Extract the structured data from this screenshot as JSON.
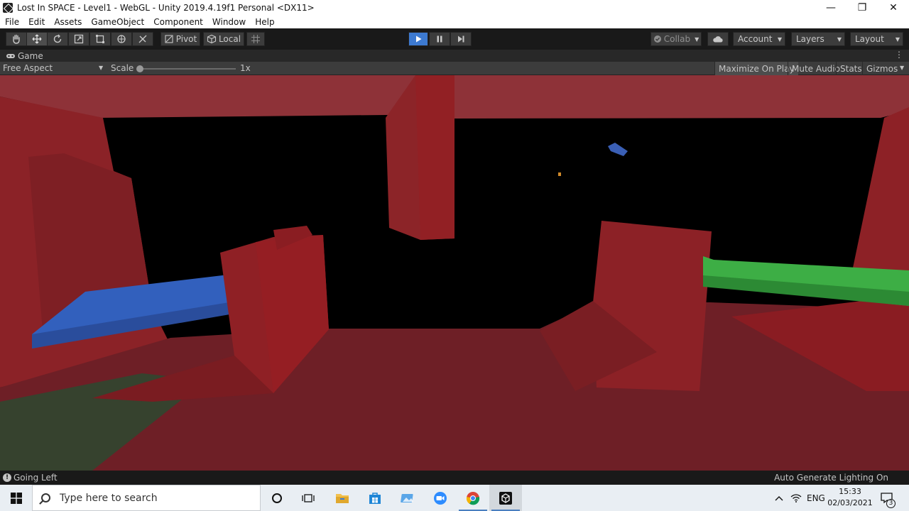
{
  "window": {
    "title": "Lost In SPACE - Level1 - WebGL - Unity 2019.4.19f1 Personal <DX11>",
    "controls": {
      "minimize": "—",
      "restore": "❐",
      "close": "✕"
    }
  },
  "menu": [
    "File",
    "Edit",
    "Assets",
    "GameObject",
    "Component",
    "Window",
    "Help"
  ],
  "toolbar": {
    "tools": [
      "hand-tool",
      "move-tool",
      "rotate-tool",
      "scale-tool",
      "rect-tool",
      "transform-tool",
      "custom-tool"
    ],
    "active_tool": "move-tool",
    "pivot_label": "Pivot",
    "local_label": "Local",
    "collab_label": "Collab",
    "account_label": "Account",
    "layers_label": "Layers",
    "layout_label": "Layout",
    "playing": true
  },
  "game_tab": {
    "label": "Game",
    "aspect": "Free Aspect",
    "scale_label": "Scale",
    "scale_value": "1x",
    "scale_slider": 0.0,
    "maximize_on_play": "Maximize On Play",
    "mute_audio": "Mute Audio",
    "stats": "Stats",
    "gizmos": "Gizmos",
    "maximize_on_play_enabled": true
  },
  "scene_colors": {
    "space": "#000000",
    "wall_red": "#8b2227",
    "floor_red": "#6e1f26",
    "blue_platform": "#2f5cb8",
    "green_platform": "#36a53e",
    "dark_green_floor": "#36422e"
  },
  "status": {
    "message": "Going Left",
    "lighting": "Auto Generate Lighting On"
  },
  "taskbar": {
    "search_placeholder": "Type here to search",
    "apps": [
      "cortana",
      "task-view",
      "file-explorer",
      "store",
      "photos",
      "zoom",
      "chrome",
      "unity"
    ],
    "active_app": "unity",
    "language": "ENG",
    "time": "15:33",
    "date": "02/03/2021",
    "notifications": "3"
  }
}
